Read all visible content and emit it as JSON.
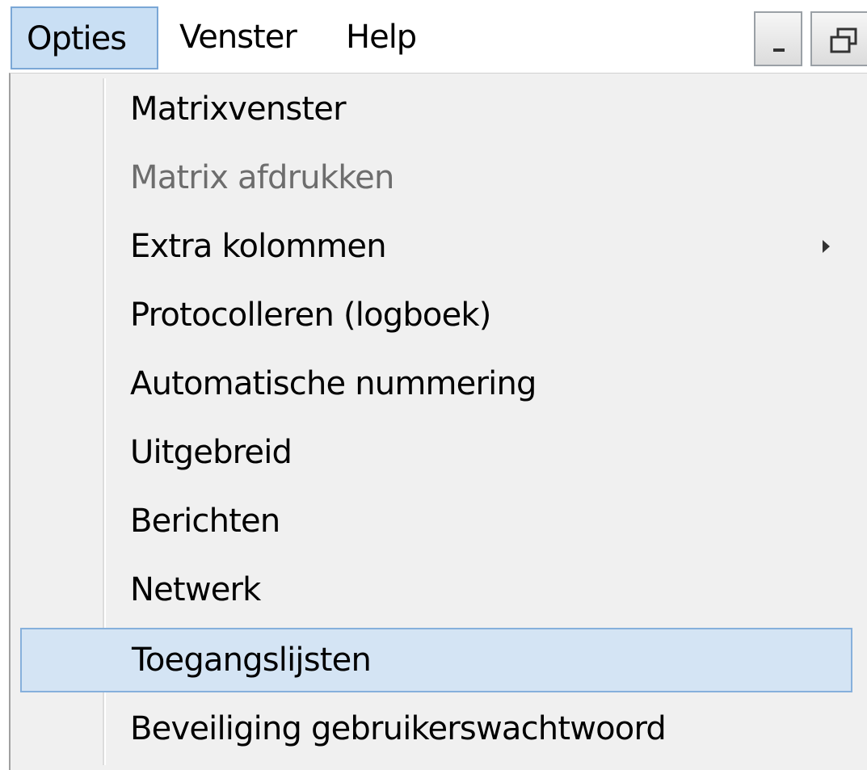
{
  "menubar": {
    "items": [
      {
        "label": "Opties",
        "active": true
      },
      {
        "label": "Venster",
        "active": false
      },
      {
        "label": "Help",
        "active": false
      }
    ]
  },
  "window_controls": {
    "minimize_icon": "minimize-icon",
    "restore_icon": "restore-icon"
  },
  "menu": {
    "items": [
      {
        "label": "Matrixvenster",
        "enabled": true
      },
      {
        "label": "Matrix afdrukken",
        "enabled": false
      },
      {
        "label": "Extra kolommen",
        "enabled": true,
        "submenu": true
      },
      {
        "label": "Protocolleren (logboek)",
        "enabled": true
      },
      {
        "label": "Automatische nummering",
        "enabled": true
      },
      {
        "label": "Uitgebreid",
        "enabled": true
      },
      {
        "label": "Berichten",
        "enabled": true
      },
      {
        "label": "Netwerk",
        "enabled": true
      },
      {
        "label": "Toegangslijsten",
        "enabled": true,
        "highlighted": true
      },
      {
        "label": "Beveiliging gebruikerswachtwoord",
        "enabled": true
      }
    ]
  },
  "colors": {
    "highlight_fill": "#d4e4f4",
    "highlight_border": "#86b0dc",
    "menu_background": "#f0f0f0",
    "disabled_text": "#6d6d6d"
  }
}
